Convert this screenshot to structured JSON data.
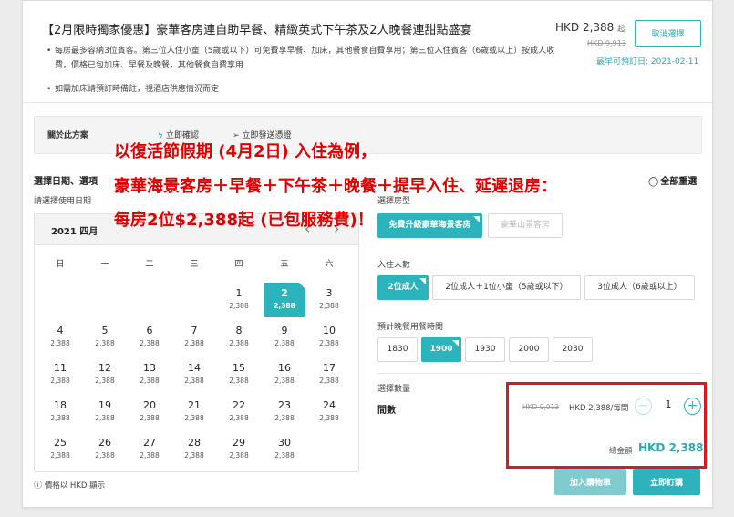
{
  "header": {
    "title": "【2月限時獨家優惠】豪華客房連自助早餐、精緻英式下午茶及2人晚餐連甜點盛宴",
    "bullets": [
      "每房最多容納3位賓客。第三位入住小童（5歲或以下）可免費享早餐、加床，其他餐食自費享用；第三位入住賓客（6歲或以上）按成人收費，價格已包加床、早餐及晚餐，其他餐食自費享用",
      "如需加床請預訂時備註，視酒店供應情況而定"
    ],
    "price": "HKD 2,388",
    "price_mark": "起",
    "old_price": "HKD 9,913",
    "cancel_label": "取消選擇",
    "earliest": "最早可預訂日: 2021-02-11"
  },
  "about": {
    "label": "關於此方案",
    "feature1": "立即確認",
    "feature2": "立即發送憑證"
  },
  "overlay": {
    "line1": "以復活節假期 (4月2日) 入住為例，",
    "line2": "豪華海景客房＋早餐＋下午茶＋晚餐＋提早入住、延遲退房：",
    "line3": "每房2位$2,388起 (已包服務費)！"
  },
  "selection": {
    "title": "選擇日期、選項",
    "subtitle": "請選擇使用日期",
    "reset": "全部重選"
  },
  "calendar": {
    "month": "2021 四月",
    "prev": "‹",
    "next": "›",
    "weekdays": [
      "日",
      "一",
      "二",
      "三",
      "四",
      "五",
      "六"
    ],
    "days": [
      {
        "n": "1",
        "p": "2,388"
      },
      {
        "n": "2",
        "p": "2,388"
      },
      {
        "n": "3",
        "p": "2,388"
      },
      {
        "n": "4",
        "p": "2,388"
      },
      {
        "n": "5",
        "p": "2,388"
      },
      {
        "n": "6",
        "p": "2,388"
      },
      {
        "n": "7",
        "p": "2,388"
      },
      {
        "n": "8",
        "p": "2,388"
      },
      {
        "n": "9",
        "p": "2,388"
      },
      {
        "n": "10",
        "p": "2,388"
      },
      {
        "n": "11",
        "p": "2,388"
      },
      {
        "n": "12",
        "p": "2,388"
      },
      {
        "n": "13",
        "p": "2,388"
      },
      {
        "n": "14",
        "p": "2,388"
      },
      {
        "n": "15",
        "p": "2,388"
      },
      {
        "n": "16",
        "p": "2,388"
      },
      {
        "n": "17",
        "p": "2,388"
      },
      {
        "n": "18",
        "p": "2,388"
      },
      {
        "n": "19",
        "p": "2,388"
      },
      {
        "n": "20",
        "p": "2,388"
      },
      {
        "n": "21",
        "p": "2,388"
      },
      {
        "n": "22",
        "p": "2,388"
      },
      {
        "n": "23",
        "p": "2,388"
      },
      {
        "n": "24",
        "p": "2,388"
      },
      {
        "n": "25",
        "p": "2,388"
      },
      {
        "n": "26",
        "p": "2,388"
      },
      {
        "n": "27",
        "p": "2,388"
      },
      {
        "n": "28",
        "p": "2,388"
      },
      {
        "n": "29",
        "p": "2,388"
      },
      {
        "n": "30",
        "p": "2,388"
      }
    ],
    "selected_day": "2",
    "note": "價格以 HKD 顯示"
  },
  "options": {
    "room_label": "選擇房型",
    "rooms": [
      "免費升級豪華海景客房",
      "豪華山景客房"
    ],
    "guests_label": "入住人數",
    "guests": [
      "2位成人",
      "2位成人＋1位小童（5歲或以下）",
      "3位成人（6歲或以上）"
    ],
    "dinner_label": "預計晚餐用餐時間",
    "times": [
      "1830",
      "1900",
      "1930",
      "2000",
      "2030"
    ],
    "qty_label": "選擇數量",
    "rooms_count_label": "間數"
  },
  "summary": {
    "unit_old": "HKD 9,913",
    "unit_price": "HKD 2,388/每間",
    "qty": "1",
    "total_label": "總金額",
    "total": "HKD 2,388",
    "cart_label": "加入購物車",
    "book_label": "立即訂購"
  },
  "colors": {
    "accent": "#2cb3bb",
    "overlay_text": "#e10000",
    "highlight_box": "#d9191f"
  }
}
